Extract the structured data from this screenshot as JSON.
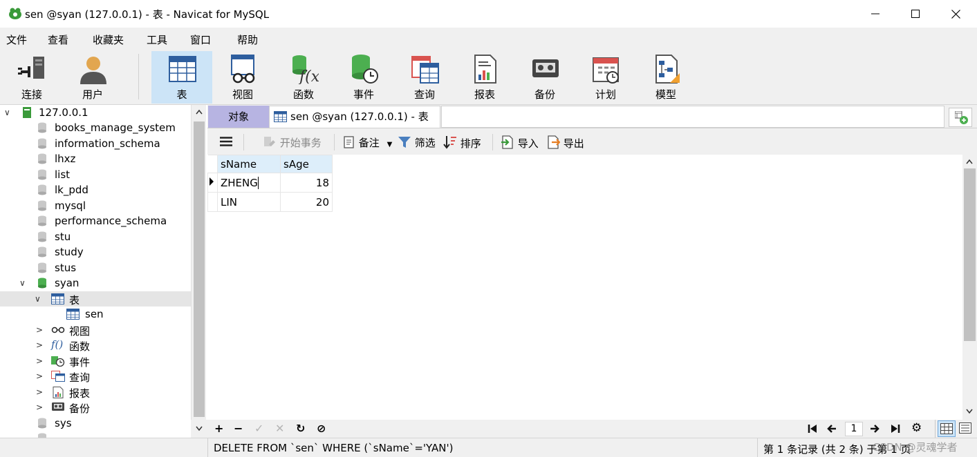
{
  "window": {
    "title": "sen @syan (127.0.0.1) - 表 - Navicat for MySQL"
  },
  "menu": [
    "文件",
    "查看",
    "收藏夹",
    "工具",
    "窗口",
    "帮助"
  ],
  "toolbar": [
    {
      "label": "连接",
      "icon": "connect-icon"
    },
    {
      "label": "用户",
      "icon": "user-icon"
    },
    {
      "label": "表",
      "icon": "table-icon",
      "active": true
    },
    {
      "label": "视图",
      "icon": "view-icon"
    },
    {
      "label": "函数",
      "icon": "function-icon"
    },
    {
      "label": "事件",
      "icon": "event-icon"
    },
    {
      "label": "查询",
      "icon": "query-icon"
    },
    {
      "label": "报表",
      "icon": "report-icon"
    },
    {
      "label": "备份",
      "icon": "backup-icon"
    },
    {
      "label": "计划",
      "icon": "schedule-icon"
    },
    {
      "label": "模型",
      "icon": "model-icon"
    }
  ],
  "tree": {
    "connection": "127.0.0.1",
    "databases": [
      "books_manage_system",
      "information_schema",
      "lhxz",
      "list",
      "lk_pdd",
      "mysql",
      "performance_schema",
      "stu",
      "study",
      "stus"
    ],
    "open_db": "syan",
    "tables_node": "表",
    "table": "sen",
    "folders": [
      "视图",
      "函数",
      "事件",
      "查询",
      "报表",
      "备份"
    ],
    "after": "sys"
  },
  "tabs": {
    "objects": "对象",
    "current": "sen @syan (127.0.0.1) - 表"
  },
  "subtoolbar": {
    "begin_tx": "开始事务",
    "note": "备注",
    "filter": "筛选",
    "sort": "排序",
    "import": "导入",
    "export": "导出"
  },
  "grid": {
    "columns": [
      "sName",
      "sAge"
    ],
    "rows": [
      [
        "ZHENG",
        "18"
      ],
      [
        "LIN",
        "20"
      ]
    ]
  },
  "pager": {
    "page": "1"
  },
  "status": {
    "sql": "DELETE FROM `sen` WHERE (`sName`='YAN')",
    "records": "第 1 条记录 (共 2 条) 于第 1 页",
    "watermark": "CSDN @灵魂学者"
  },
  "colors": {
    "active_tab": "#b7b4e2",
    "toolbar_active": "#cce4f7",
    "header_bg": "#ddeefa",
    "db_icon": "#4caf50"
  }
}
